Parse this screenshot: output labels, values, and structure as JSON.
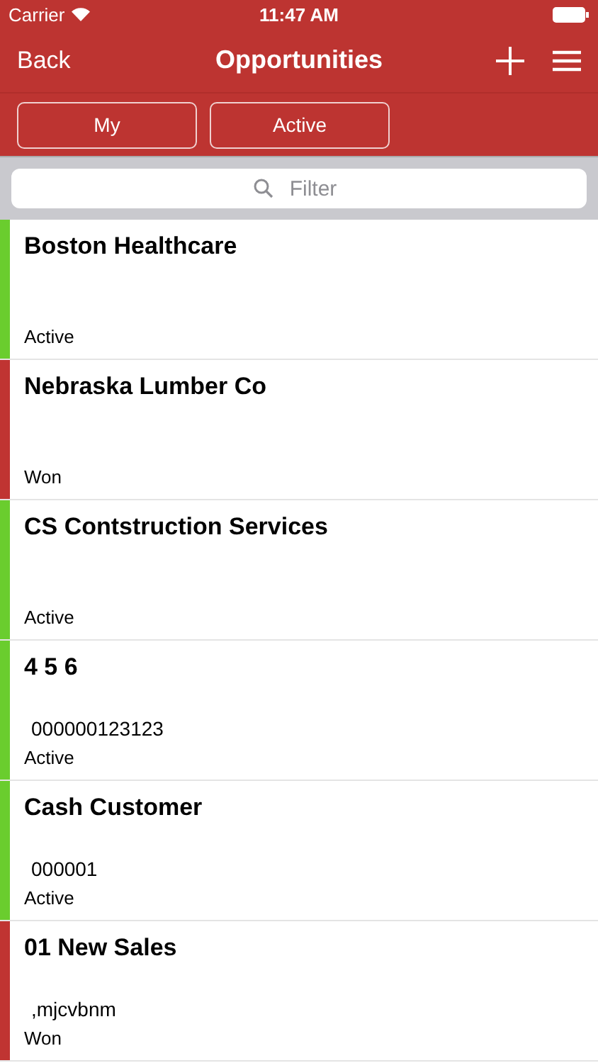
{
  "status_bar": {
    "carrier": "Carrier",
    "time": "11:47 AM"
  },
  "nav": {
    "back": "Back",
    "title": "Opportunities"
  },
  "filters": [
    {
      "label": "My"
    },
    {
      "label": "Active"
    }
  ],
  "search": {
    "placeholder": "Filter"
  },
  "rows": [
    {
      "title": "Boston Healthcare",
      "status": "Active",
      "color": "#6acd2e"
    },
    {
      "title": "Nebraska Lumber Co",
      "status": "Won",
      "color": "#c03432"
    },
    {
      "title": "CS Contstruction Services",
      "status": "Active",
      "color": "#6acd2e"
    },
    {
      "title": "4 5 6",
      "code": "000000123123",
      "status": "Active",
      "color": "#6acd2e"
    },
    {
      "title": "Cash Customer",
      "code": "000001",
      "status": "Active",
      "color": "#6acd2e"
    },
    {
      "title": "01 New Sales",
      "code": ",mjcvbnm",
      "status": "Won",
      "color": "#c03432"
    }
  ]
}
